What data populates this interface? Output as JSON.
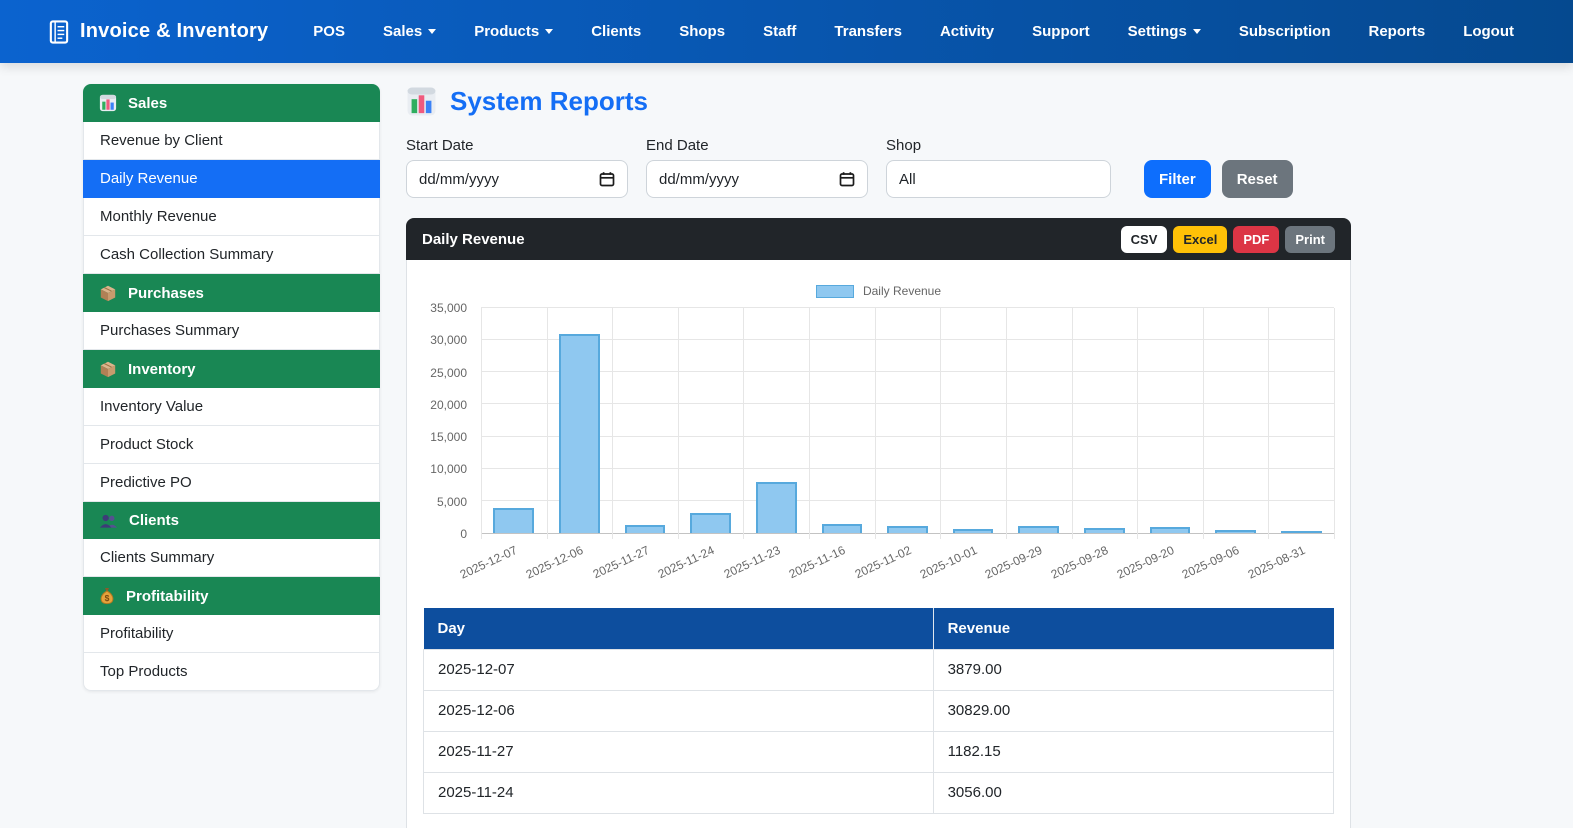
{
  "navbar": {
    "brand": "Invoice & Inventory",
    "items": [
      {
        "label": "POS",
        "dropdown": false
      },
      {
        "label": "Sales",
        "dropdown": true
      },
      {
        "label": "Products",
        "dropdown": true
      },
      {
        "label": "Clients",
        "dropdown": false
      },
      {
        "label": "Shops",
        "dropdown": false
      },
      {
        "label": "Staff",
        "dropdown": false
      },
      {
        "label": "Transfers",
        "dropdown": false
      },
      {
        "label": "Activity",
        "dropdown": false
      },
      {
        "label": "Support",
        "dropdown": false
      },
      {
        "label": "Settings",
        "dropdown": true
      },
      {
        "label": "Subscription",
        "dropdown": false
      },
      {
        "label": "Reports",
        "dropdown": false
      },
      {
        "label": "Logout",
        "dropdown": false
      }
    ]
  },
  "sidebar": {
    "sections": [
      {
        "title": "Sales",
        "icon": "bar-chart-icon",
        "items": [
          {
            "label": "Revenue by Client",
            "active": false
          },
          {
            "label": "Daily Revenue",
            "active": true
          },
          {
            "label": "Monthly Revenue",
            "active": false
          },
          {
            "label": "Cash Collection Summary",
            "active": false
          }
        ]
      },
      {
        "title": "Purchases",
        "icon": "box-icon",
        "items": [
          {
            "label": "Purchases Summary",
            "active": false
          }
        ]
      },
      {
        "title": "Inventory",
        "icon": "box-icon",
        "items": [
          {
            "label": "Inventory Value",
            "active": false
          },
          {
            "label": "Product Stock",
            "active": false
          },
          {
            "label": "Predictive PO",
            "active": false
          }
        ]
      },
      {
        "title": "Clients",
        "icon": "clients-icon",
        "items": [
          {
            "label": "Clients Summary",
            "active": false
          }
        ]
      },
      {
        "title": "Profitability",
        "icon": "money-bag-icon",
        "items": [
          {
            "label": "Profitability",
            "active": false
          },
          {
            "label": "Top Products",
            "active": false
          }
        ]
      }
    ]
  },
  "page": {
    "title": "System Reports",
    "title_icon": "bar-chart-icon"
  },
  "filters": {
    "start_date": {
      "label": "Start Date",
      "placeholder": "dd/mm/yyyy"
    },
    "end_date": {
      "label": "End Date",
      "placeholder": "dd/mm/yyyy"
    },
    "shop": {
      "label": "Shop",
      "value": "All"
    },
    "filter_button": "Filter",
    "reset_button": "Reset"
  },
  "report_card": {
    "title": "Daily Revenue",
    "export_buttons": [
      {
        "label": "CSV",
        "style": "light"
      },
      {
        "label": "Excel",
        "style": "warning"
      },
      {
        "label": "PDF",
        "style": "danger"
      },
      {
        "label": "Print",
        "style": "secondary"
      }
    ]
  },
  "chart_data": {
    "type": "bar",
    "title": "",
    "legend": "Daily Revenue",
    "legend_position": "top",
    "grid": true,
    "xlabel": "",
    "ylabel": "",
    "ylim": [
      0,
      35000
    ],
    "ytick_step": 5000,
    "categories": [
      "2025-12-07",
      "2025-12-06",
      "2025-11-27",
      "2025-11-24",
      "2025-11-23",
      "2025-11-16",
      "2025-11-02",
      "2025-10-01",
      "2025-09-29",
      "2025-09-28",
      "2025-09-20",
      "2025-09-06",
      "2025-08-31"
    ],
    "values": [
      3879,
      30829,
      1182.15,
      3056,
      7900,
      1450,
      1100,
      650,
      1150,
      850,
      950,
      500,
      300
    ],
    "bar_fill": "#8fc8f0",
    "bar_border": "#57a9dd"
  },
  "table": {
    "header_bg": "#0d4e9e",
    "columns": [
      "Day",
      "Revenue"
    ],
    "rows": [
      [
        "2025-12-07",
        "3879.00"
      ],
      [
        "2025-12-06",
        "30829.00"
      ],
      [
        "2025-11-27",
        "1182.15"
      ],
      [
        "2025-11-24",
        "3056.00"
      ]
    ]
  },
  "colors": {
    "navbar_gradient_start": "#0b63cf",
    "navbar_gradient_end": "#05498f",
    "sidebar_header_green": "#198754",
    "active_item_blue": "#146ef5",
    "title_blue": "#146ef5",
    "filter_button_blue": "#0d6efd",
    "reset_button_gray": "#6c757d",
    "card_header_dark": "#212529",
    "excel_yellow": "#ffc107",
    "pdf_red": "#dc3545",
    "table_header_blue": "#0d4e9e",
    "bar_fill": "#8fc8f0",
    "bar_border": "#57a9dd"
  }
}
